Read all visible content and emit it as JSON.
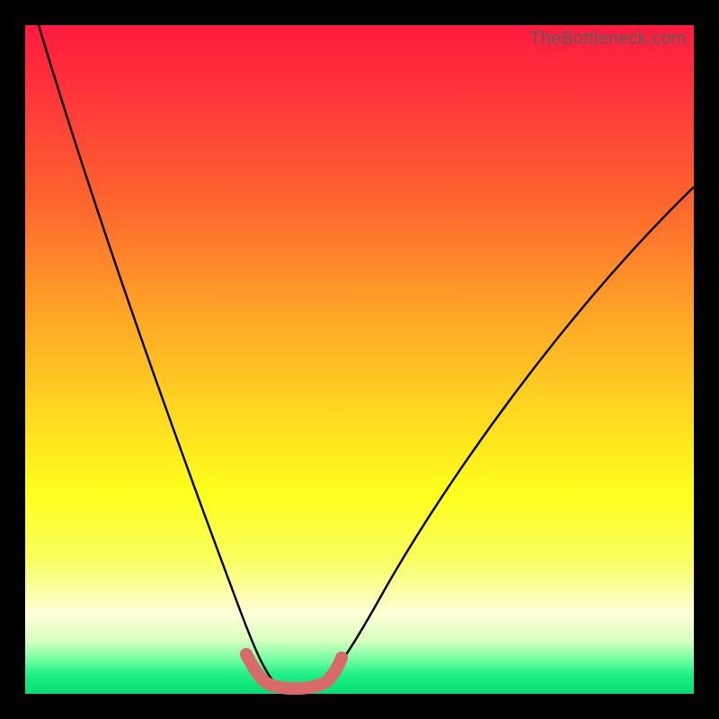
{
  "watermark": "TheBottleneck.com",
  "chart_data": {
    "type": "line",
    "title": "",
    "xlabel": "",
    "ylabel": "",
    "xlim": [
      0,
      100
    ],
    "ylim": [
      0,
      100
    ],
    "series": [
      {
        "name": "bottleneck-curve",
        "x": [
          2,
          6,
          10,
          14,
          18,
          22,
          26,
          29,
          31,
          33,
          34.5,
          36,
          38,
          40,
          42,
          44,
          47,
          54,
          62,
          70,
          78,
          86,
          94,
          100
        ],
        "values": [
          100,
          90,
          78,
          66,
          55,
          44,
          33,
          22,
          13,
          6,
          2.5,
          0.8,
          0,
          0,
          0.8,
          2.5,
          6,
          16,
          28,
          40,
          50,
          60,
          68,
          74
        ]
      },
      {
        "name": "flat-bottom-marker",
        "x": [
          33,
          34,
          35,
          36,
          37,
          38,
          39,
          40,
          41,
          42,
          43,
          44,
          45,
          46,
          47
        ],
        "values": [
          5,
          3,
          1.8,
          1.2,
          0.9,
          0.8,
          0.8,
          0.8,
          0.8,
          0.9,
          1.2,
          1.8,
          3,
          4.2,
          5.5
        ]
      }
    ],
    "gradient_stops": [
      {
        "pos": 0,
        "color": "#ff1a3f"
      },
      {
        "pos": 28,
        "color": "#ff6a2e"
      },
      {
        "pos": 58,
        "color": "#ffd820"
      },
      {
        "pos": 80,
        "color": "#f8ff60"
      },
      {
        "pos": 95,
        "color": "#70ffa0"
      },
      {
        "pos": 100,
        "color": "#0cd874"
      }
    ]
  }
}
